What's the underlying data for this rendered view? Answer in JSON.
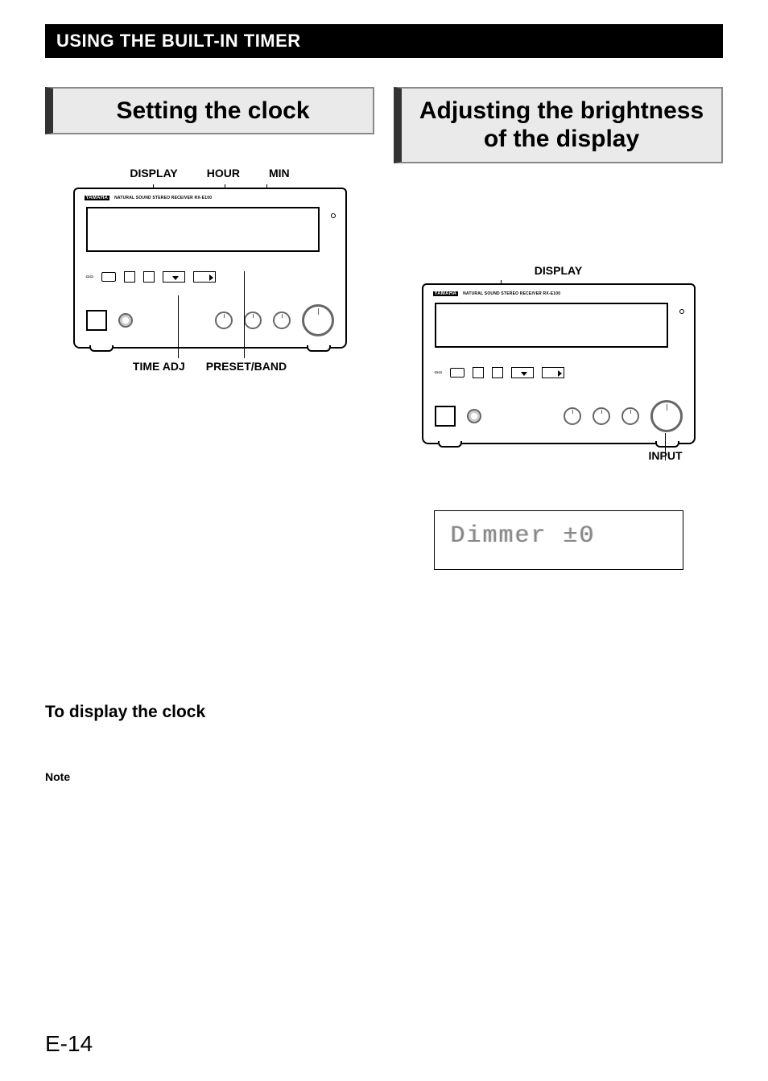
{
  "header": {
    "title": "USING THE BUILT-IN TIMER"
  },
  "left": {
    "section_title": "Setting the clock",
    "top_labels": {
      "display": "DISPLAY",
      "hour": "HOUR",
      "min": "MIN"
    },
    "bottom_labels": {
      "time_adj": "TIME ADJ",
      "preset_band": "PRESET/BAND"
    },
    "sub_heading": "To display the clock",
    "note_label": "Note"
  },
  "right": {
    "section_title": "Adjusting the brightness of the display",
    "top_label": "DISPLAY",
    "bottom_label": "INPUT",
    "lcd_text": "Dimmer ±0"
  },
  "device": {
    "brand": "YAMAHA",
    "model_text": "NATURAL SOUND STEREO RECEIVER RX-E100"
  },
  "page_number": "E-14",
  "icons": {
    "knob": "knob-icon",
    "button": "button-icon",
    "screen": "screen-icon"
  }
}
